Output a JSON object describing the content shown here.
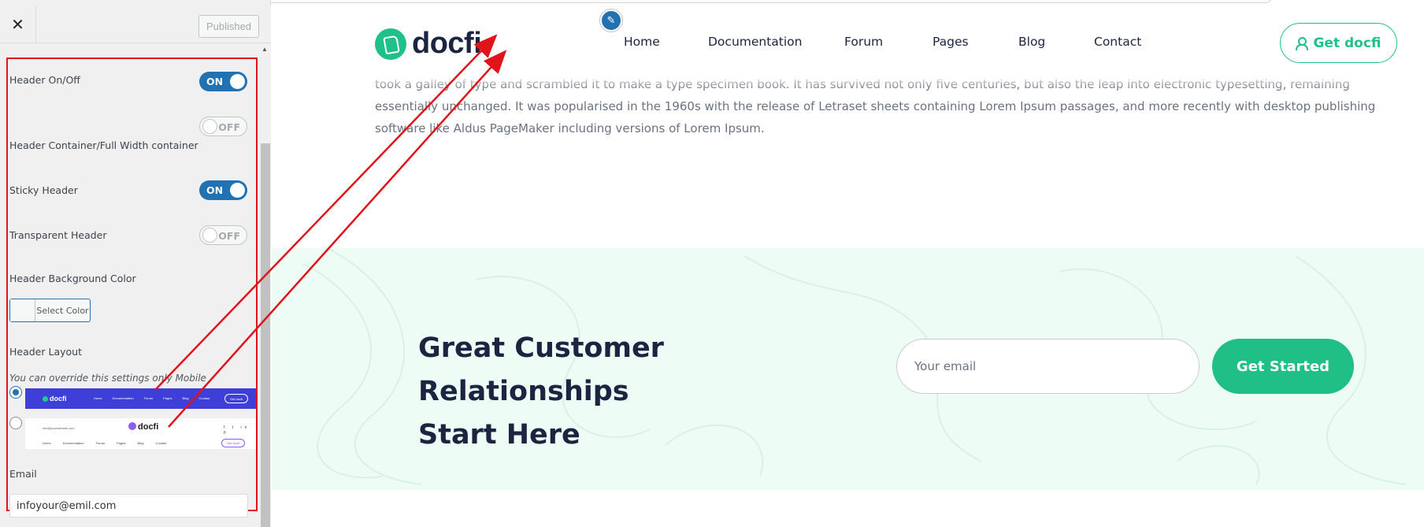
{
  "customizer": {
    "close_glyph": "✕",
    "published_label": "Published",
    "fields": {
      "header_onoff": {
        "label": "Header On/Off",
        "state": "ON"
      },
      "header_container": {
        "label": "Header Container/Full Width container",
        "state": "OFF"
      },
      "sticky_header": {
        "label": "Sticky Header",
        "state": "ON"
      },
      "transparent_header": {
        "label": "Transparent Header",
        "state": "OFF"
      },
      "bg_color": {
        "label": "Header Background Color",
        "button_label": "Select Color"
      },
      "header_layout": {
        "label": "Header Layout",
        "hint": "You can override this settings only Mobile",
        "layout1": {
          "logo": "docfi",
          "nav": [
            "Home",
            "Documentation",
            "Forum",
            "Pages",
            "Blog",
            "Contact"
          ],
          "button": "Get docfi"
        },
        "layout2": {
          "email": "info@yourwebsite.com",
          "logo": "docfi",
          "social": "f t in p",
          "nav": [
            "Home",
            "Documentation",
            "Forum",
            "Pages",
            "Blog",
            "Contact"
          ],
          "button": "Get docfi"
        }
      },
      "email": {
        "label": "Email",
        "value": "infoyour@emil.com"
      }
    }
  },
  "site": {
    "brand": "docfi",
    "nav": [
      "Home",
      "Documentation",
      "Forum",
      "Pages",
      "Blog",
      "Contact"
    ],
    "cta": "Get docfi",
    "hero_text": "took a galley of type and scrambled it to make a type specimen book. It has survived not only five centuries, but also the leap into electronic typesetting, remaining essentially unchanged. It was popularised in the 1960s with the release of Letraset sheets containing Lorem Ipsum passages, and more recently with desktop publishing software like Aldus PageMaker including versions of Lorem Ipsum.",
    "band": {
      "title_line1": "Great Customer Relationships",
      "title_line2": "Start Here",
      "email_placeholder": "Your email",
      "button": "Get Started"
    }
  },
  "colors": {
    "accent_green": "#20c08a",
    "wp_blue": "#2271b1",
    "annotation_red": "#e0141b",
    "navy": "#1b2440"
  }
}
